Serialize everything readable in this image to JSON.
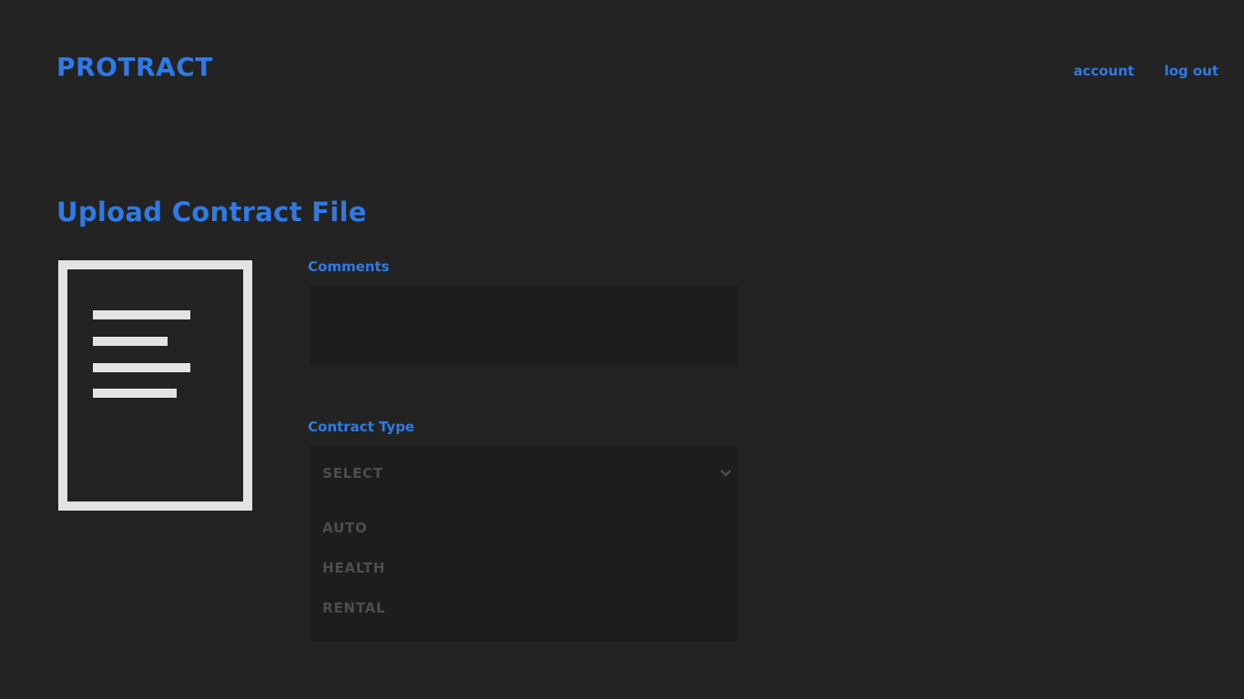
{
  "header": {
    "logo": "PROTRACT",
    "nav": {
      "account": "account",
      "logout": "log out"
    }
  },
  "main": {
    "title": "Upload Contract File",
    "file_icon": "document-icon",
    "comments": {
      "label": "Comments",
      "value": ""
    },
    "contract_type": {
      "label": "Contract Type",
      "selected": "SELECT",
      "chevron_icon": "chevron-down-icon",
      "options": [
        "AUTO",
        "HEALTH",
        "RENTAL"
      ]
    }
  },
  "colors": {
    "background": "#232323",
    "accent": "#2f7ae5",
    "field_background": "#1e1d1e",
    "icon": "#e2e4e3",
    "muted_text": "#4d4d4d"
  }
}
